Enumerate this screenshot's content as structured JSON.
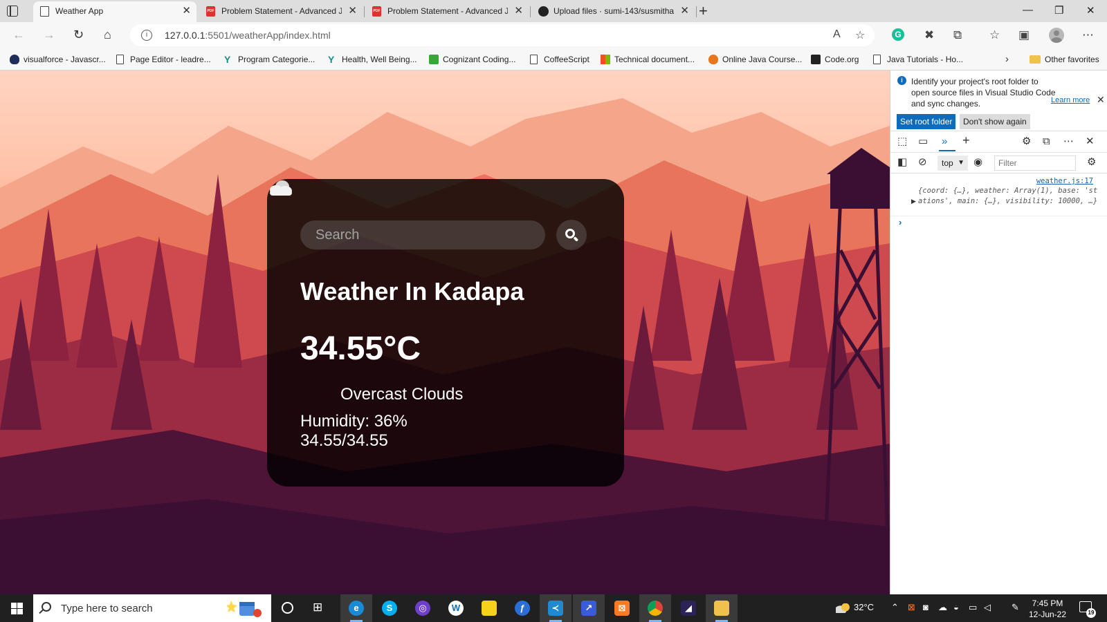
{
  "browser": {
    "tabs": [
      {
        "label": "Weather App",
        "icon": "page-icon",
        "active": true
      },
      {
        "label": "Problem Statement - Advanced J",
        "icon": "pdf-icon"
      },
      {
        "label": "Problem Statement - Advanced J",
        "icon": "pdf-icon"
      },
      {
        "label": "Upload files · sumi-143/susmitha",
        "icon": "github-icon"
      }
    ],
    "url_host": "127.0.0.1",
    "url_path": ":5501/weatherApp/index.html",
    "favorites": [
      {
        "label": "visualforce - Javascr...",
        "icon": "salesforce-icon"
      },
      {
        "label": "Page Editor - leadre...",
        "icon": "page-icon"
      },
      {
        "label": "Program Categorie...",
        "icon": "yantra-icon"
      },
      {
        "label": "Health, Well Being...",
        "icon": "yantra-icon"
      },
      {
        "label": "Cognizant Coding...",
        "icon": "cognizant-icon"
      },
      {
        "label": "CoffeeScript",
        "icon": "page-icon"
      },
      {
        "label": "Technical document...",
        "icon": "microsoft-icon"
      },
      {
        "label": "Online Java Course...",
        "icon": "java-icon"
      },
      {
        "label": "Code.org",
        "icon": "code-org-icon"
      },
      {
        "label": "Java Tutorials - Ho...",
        "icon": "page-icon"
      }
    ],
    "other_favorites": "Other favorites"
  },
  "weather": {
    "search_placeholder": "Search",
    "city": "Weather In Kadapa",
    "temperature": "34.55°C",
    "description": "Overcast Clouds",
    "humidity": "Humidity: 36%",
    "min_max": "34.55/34.55",
    "icon": "overcast-clouds-icon"
  },
  "devtools": {
    "info_text": "Identify your project's root folder to open source files in Visual Studio Code and sync changes.",
    "learn_more": "Learn more",
    "set_root": "Set root folder",
    "dont_show": "Don't show again",
    "context": "top",
    "filter_placeholder": "Filter",
    "log_source": "weather.js:17",
    "log_object": "{coord: {…}, weather: Array(1), base: 'stations', main: {…}, visibility: 10000, …}"
  },
  "taskbar": {
    "search_placeholder": "Type here to search",
    "weather": "32°C",
    "time": "7:45 PM",
    "date": "12-Jun-22",
    "notifications": "19"
  },
  "colors": {
    "card_bg": "rgba(0,0,0,0.82)",
    "accent": "#0f6cbd",
    "sky_top": "#ffd4c2",
    "forest_dark": "#3d1033"
  }
}
